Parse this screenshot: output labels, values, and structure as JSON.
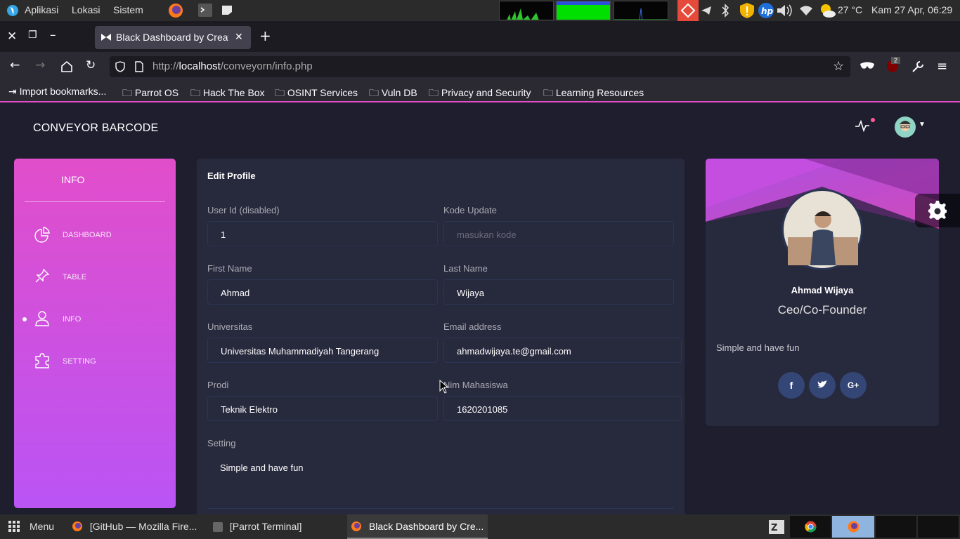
{
  "os_panel": {
    "menus": [
      "Aplikasi",
      "Lokasi",
      "Sistem"
    ],
    "temperature": "27 °C",
    "clock": "Kam 27 Apr, 06:29",
    "badge_count": ""
  },
  "browser": {
    "tab_title": "Black Dashboard by Creat",
    "url_prefix": "http://",
    "url_host": "localhost",
    "url_path": "/conveyorn/info.php",
    "addon_badge": "2",
    "bookmarks": [
      "Import bookmarks...",
      "Parrot OS",
      "Hack The Box",
      "OSINT Services",
      "Vuln DB",
      "Privacy and Security",
      "Learning Resources"
    ]
  },
  "page": {
    "brand": "CONVEYOR BARCODE",
    "sidebar": {
      "title": "INFO",
      "items": [
        {
          "label": "DASHBOARD",
          "icon": "chart-pie-icon"
        },
        {
          "label": "TABLE",
          "icon": "pin-icon"
        },
        {
          "label": "INFO",
          "icon": "user-icon"
        },
        {
          "label": "SETTING",
          "icon": "puzzle-icon"
        }
      ]
    },
    "form": {
      "title": "Edit Profile",
      "user_id_label": "User Id (disabled)",
      "user_id_value": "1",
      "kode_label": "Kode Update",
      "kode_placeholder": "masukan kode",
      "first_name_label": "First Name",
      "first_name_value": "Ahmad",
      "last_name_label": "Last Name",
      "last_name_value": "Wijaya",
      "univ_label": "Universitas",
      "univ_value": "Universitas Muhammadiyah Tangerang",
      "email_label": "Email address",
      "email_value": "ahmadwijaya.te@gmail.com",
      "prodi_label": "Prodi",
      "prodi_value": "Teknik Elektro",
      "nim_label": "Nim Mahasiswa",
      "nim_value": "1620201085",
      "setting_label": "Setting",
      "setting_value": "Simple and have fun"
    },
    "profile": {
      "name": "Ahmad Wijaya",
      "role": "Ceo/Co-Founder",
      "bio": "Simple and have fun",
      "social": [
        "facebook-icon",
        "twitter-icon",
        "google-plus-icon"
      ]
    }
  },
  "taskbar": {
    "menu": "Menu",
    "tasks": [
      "[GitHub — Mozilla Fire...",
      "[Parrot Terminal]",
      "Black Dashboard by Cre..."
    ]
  },
  "colors": {
    "accent_pink": "#e14eca",
    "accent_purple": "#ba54f5",
    "card_bg": "#27293d",
    "page_bg": "#1e1e2f"
  }
}
